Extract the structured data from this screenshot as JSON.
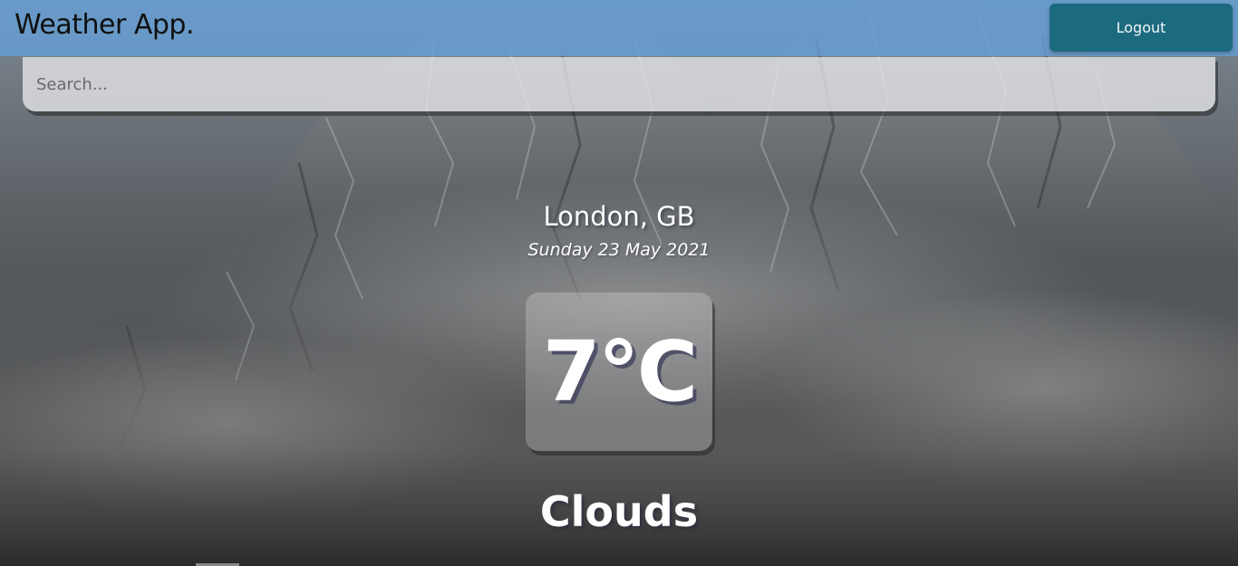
{
  "navbar": {
    "brand": "Weather App.",
    "logout_label": "Logout",
    "color": "#649ed4",
    "button_color": "#1b6a7e"
  },
  "search": {
    "placeholder": "Search...",
    "value": ""
  },
  "weather": {
    "location": "London, GB",
    "date": "Sunday 23 May 2021",
    "temperature": "7°C",
    "condition": "Clouds"
  },
  "background": {
    "description_icon": "mountain-background-image"
  }
}
